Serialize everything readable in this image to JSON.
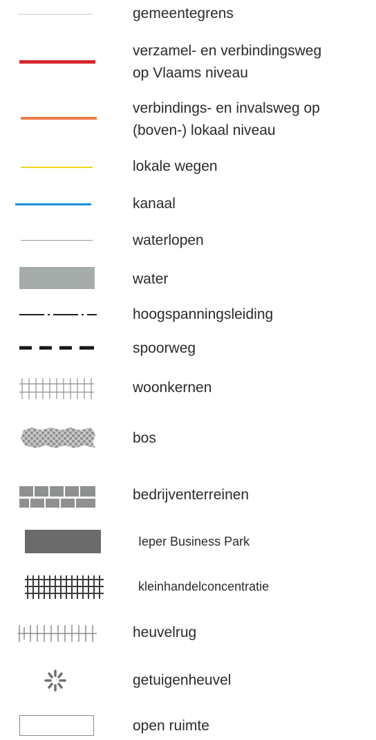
{
  "legend": {
    "items": [
      {
        "id": "gemeentegrens",
        "label": "gemeentegrens",
        "color": "#c8c8c8"
      },
      {
        "id": "verzamelweg",
        "label_line1": "verzamel- en verbindingsweg",
        "label_line2": "op Vlaams niveau",
        "color": "#d42a2e"
      },
      {
        "id": "invalsweg",
        "label_line1": "verbindings- en invalsweg op",
        "label_line2": "(boven-) lokaal niveau",
        "color": "#ee7a45"
      },
      {
        "id": "lokale-wegen",
        "label": "lokale wegen",
        "color": "#e8d81c"
      },
      {
        "id": "kanaal",
        "label": "kanaal",
        "color": "#1a8ed8"
      },
      {
        "id": "waterlopen",
        "label": "waterlopen",
        "color": "#9a9a9a"
      },
      {
        "id": "water",
        "label": "water",
        "color": "#a6acaa"
      },
      {
        "id": "hoogspanningsleiding",
        "label": "hoogspanningsleiding",
        "color": "#1c1c1c"
      },
      {
        "id": "spoorweg",
        "label": "spoorweg",
        "color": "#161616"
      },
      {
        "id": "woonkernen",
        "label": "woonkernen",
        "color": "#8e8e8e"
      },
      {
        "id": "bos",
        "label": "bos",
        "color": "#9a9a9a"
      },
      {
        "id": "bedrijventerreinen",
        "label": "bedrijventerreinen",
        "color": "#8e9190"
      },
      {
        "id": "business-park",
        "label": "Ieper Business Park",
        "color": "#6b6b6b"
      },
      {
        "id": "kleinhandel",
        "label": "kleinhandelconcentratie",
        "color": "#3a3a3a"
      },
      {
        "id": "heuvelrug",
        "label": "heuvelrug",
        "color": "#8a8a8a"
      },
      {
        "id": "getuigenheuvel",
        "label": "getuigenheuvel",
        "color": "#707070"
      },
      {
        "id": "open-ruimte",
        "label": "open ruimte",
        "color": "#8a8a8a"
      }
    ]
  }
}
